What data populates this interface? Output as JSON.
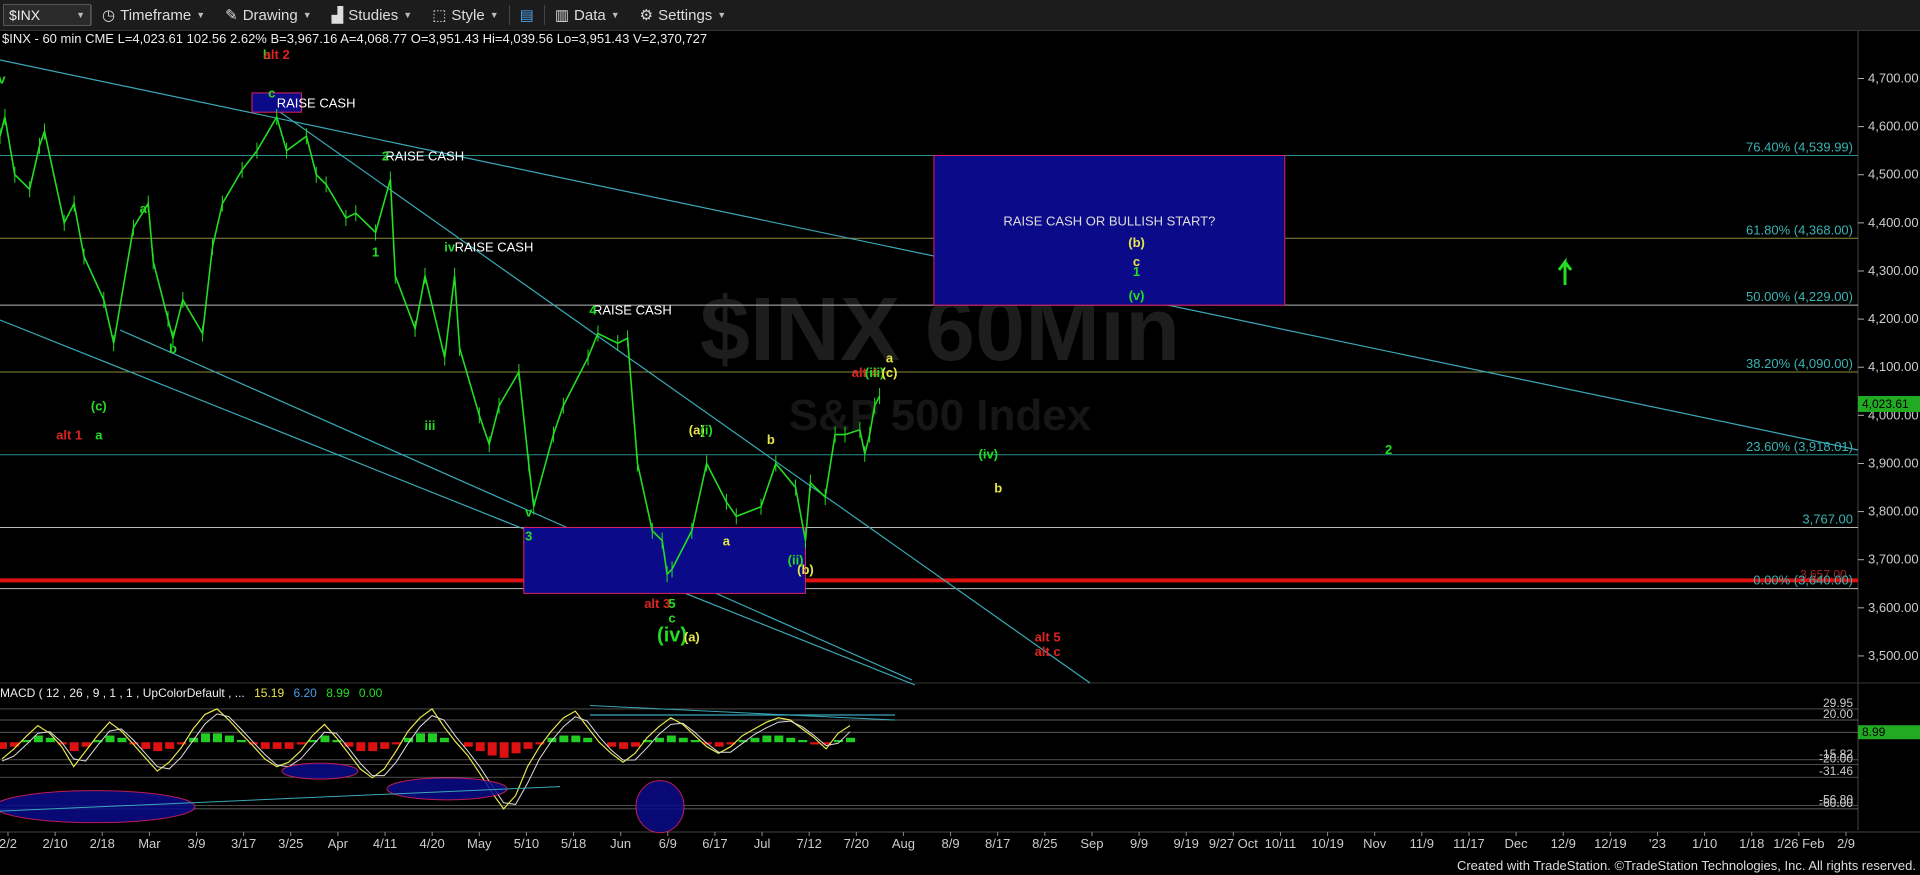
{
  "toolbar": {
    "symbol": "$INX",
    "timeframe": "Timeframe",
    "drawing": "Drawing",
    "studies": "Studies",
    "style": "Style",
    "data": "Data",
    "settings": "Settings"
  },
  "info": {
    "text": "$INX - 60 min  CME  L=4,023.61  102.56  2.62%  B=3,967.16  A=4,068.77  O=3,951.43  Hi=4,039.56  Lo=3,951.43  V=2,370,727"
  },
  "watermark": {
    "line1": "$INX 60Min",
    "line2": "S&P 500 Index"
  },
  "macd_header": {
    "label": "MACD ( 12 , 26 , 9 , 1 , 1 , UpColorDefault , ...",
    "v1": "15.19",
    "v2": "6.20",
    "v3": "8.99",
    "v4": "0.00"
  },
  "credit": "Created with TradeStation. ©TradeStation Technologies, Inc. All rights reserved.",
  "colors": {
    "up": "#22dd22",
    "raise_box": "#0b0b8a",
    "box_border": "#dd2266",
    "trend": "#3aa8b8",
    "fib": "#2a8f8f",
    "red_line": "#dd1111",
    "yellow": "#e6e64a",
    "macd_line": "#e6e64a",
    "macd_hist_up": "#22cc22",
    "macd_hist_dn": "#dd1111"
  },
  "chart_data": {
    "type": "line",
    "title": "$INX - 60 min",
    "price_axis": {
      "ticks": [
        "4,700.00",
        "4,600.00",
        "4,500.00",
        "4,400.00",
        "4,300.00",
        "4,200.00",
        "4,100.00",
        "4,000.00",
        "3,900.00",
        "3,800.00",
        "3,700.00",
        "3,600.00",
        "3,500.00"
      ],
      "ylim": [
        3450,
        4780
      ]
    },
    "date_axis": [
      "2/2",
      "2/10",
      "2/18",
      "Mar",
      "3/9",
      "3/17",
      "3/25",
      "Apr",
      "4/11",
      "4/20",
      "May",
      "5/10",
      "5/18",
      "Jun",
      "6/9",
      "6/17",
      "Jul",
      "7/12",
      "7/20",
      "Aug",
      "8/9",
      "8/17",
      "8/25",
      "Sep",
      "9/9",
      "9/19",
      "9/27 Oct",
      "10/11",
      "10/19",
      "Nov",
      "11/9",
      "11/17",
      "Dec",
      "12/9",
      "12/19",
      "'23",
      "1/10",
      "1/18",
      "1/26 Feb",
      "2/9"
    ],
    "last_price": "4,023.61",
    "price_path": [
      [
        "2/1",
        4580
      ],
      [
        "2/2",
        4620
      ],
      [
        "2/4",
        4500
      ],
      [
        "2/7",
        4470
      ],
      [
        "2/9",
        4560
      ],
      [
        "2/10",
        4590
      ],
      [
        "2/14",
        4400
      ],
      [
        "2/16",
        4440
      ],
      [
        "2/18",
        4330
      ],
      [
        "2/22",
        4240
      ],
      [
        "2/24",
        4150
      ],
      [
        "2/28",
        4390
      ],
      [
        "3/3",
        4440
      ],
      [
        "3/4",
        4320
      ],
      [
        "3/7",
        4200
      ],
      [
        "3/8",
        4160
      ],
      [
        "3/10",
        4240
      ],
      [
        "3/14",
        4170
      ],
      [
        "3/16",
        4350
      ],
      [
        "3/18",
        4440
      ],
      [
        "3/22",
        4510
      ],
      [
        "3/25",
        4550
      ],
      [
        "3/29",
        4620
      ],
      [
        "3/31",
        4550
      ],
      [
        "4/4",
        4580
      ],
      [
        "4/6",
        4500
      ],
      [
        "4/8",
        4480
      ],
      [
        "4/12",
        4410
      ],
      [
        "4/14",
        4420
      ],
      [
        "4/18",
        4380
      ],
      [
        "4/21",
        4490
      ],
      [
        "4/22",
        4290
      ],
      [
        "4/26",
        4180
      ],
      [
        "4/28",
        4290
      ],
      [
        "5/2",
        4120
      ],
      [
        "5/4",
        4290
      ],
      [
        "5/5",
        4140
      ],
      [
        "5/9",
        4000
      ],
      [
        "5/11",
        3940
      ],
      [
        "5/13",
        4020
      ],
      [
        "5/17",
        4090
      ],
      [
        "5/19",
        3900
      ],
      [
        "5/20",
        3810
      ],
      [
        "5/24",
        3960
      ],
      [
        "5/26",
        4020
      ],
      [
        "5/31",
        4120
      ],
      [
        "6/2",
        4170
      ],
      [
        "6/6",
        4150
      ],
      [
        "6/8",
        4160
      ],
      [
        "6/10",
        3900
      ],
      [
        "6/13",
        3760
      ],
      [
        "6/15",
        3740
      ],
      [
        "6/16",
        3670
      ],
      [
        "6/17",
        3680
      ],
      [
        "6/21",
        3760
      ],
      [
        "6/24",
        3900
      ],
      [
        "6/28",
        3820
      ],
      [
        "6/30",
        3790
      ],
      [
        "7/5",
        3810
      ],
      [
        "7/8",
        3900
      ],
      [
        "7/12",
        3850
      ],
      [
        "7/14",
        3740
      ],
      [
        "7/15",
        3860
      ],
      [
        "7/18",
        3830
      ],
      [
        "7/20",
        3960
      ],
      [
        "7/22",
        3960
      ],
      [
        "7/25",
        3970
      ],
      [
        "7/26",
        3920
      ],
      [
        "7/27",
        3960
      ],
      [
        "7/28",
        4020
      ],
      [
        "7/29",
        4040
      ]
    ],
    "horizontal_levels": [
      {
        "label": "76.40% (4,539.99)",
        "value": 4539.99
      },
      {
        "label": "61.80% (4,368.00)",
        "value": 4368.0
      },
      {
        "label": "50.00% (4,229.00)",
        "value": 4229.0
      },
      {
        "label": "38.20% (4,090.00)",
        "value": 4090.0
      },
      {
        "label": "23.60% (3,918.01)",
        "value": 3918.01
      },
      {
        "label": "3,767.00",
        "value": 3767.0
      },
      {
        "label": "0.00% (3,640.00)",
        "value": 3640.0
      }
    ],
    "red_level": {
      "label": "3,657.00",
      "value": 3657
    },
    "boxes": [
      {
        "label": "RAISE CASH OR BULLISH START?",
        "x0": "8/9",
        "x1": "10/19",
        "y0": 4229,
        "y1": 4539.99
      }
    ],
    "annotations": [
      {
        "text": "RAISE CASH",
        "x": "3/29",
        "y": 4640
      },
      {
        "text": "RAISE CASH",
        "x": "4/20",
        "y": 4530
      },
      {
        "text": "RAISE CASH",
        "x": "5/4",
        "y": 4340
      },
      {
        "text": "RAISE CASH",
        "x": "6/1",
        "y": 4210
      },
      {
        "text": "iv",
        "x": "2/1",
        "y": 4690,
        "color": "green"
      },
      {
        "text": "b",
        "x": "3/27",
        "y": 4740,
        "color": "green"
      },
      {
        "text": "alt 2",
        "x": "3/29",
        "y": 4740,
        "color": "red"
      },
      {
        "text": "c",
        "x": "3/28",
        "y": 4660,
        "color": "green"
      },
      {
        "text": "a",
        "x": "3/2",
        "y": 4420,
        "color": "green"
      },
      {
        "text": "b",
        "x": "3/8",
        "y": 4130,
        "color": "green"
      },
      {
        "text": "(c)",
        "x": "2/21",
        "y": 4010,
        "color": "green"
      },
      {
        "text": "a",
        "x": "2/21",
        "y": 3950,
        "color": "green"
      },
      {
        "text": "alt 1",
        "x": "2/15",
        "y": 3950,
        "color": "red"
      },
      {
        "text": "2",
        "x": "4/20",
        "y": 4530,
        "color": "green"
      },
      {
        "text": "1",
        "x": "4/18",
        "y": 4330,
        "color": "green"
      },
      {
        "text": "iv",
        "x": "5/3",
        "y": 4340,
        "color": "green"
      },
      {
        "text": "iii",
        "x": "4/29",
        "y": 3970,
        "color": "green"
      },
      {
        "text": "v",
        "x": "5/19",
        "y": 3790,
        "color": "green"
      },
      {
        "text": "3",
        "x": "5/19",
        "y": 3740,
        "color": "green"
      },
      {
        "text": "4",
        "x": "6/1",
        "y": 4210,
        "color": "green"
      },
      {
        "text": "alt 3",
        "x": "6/14",
        "y": 3600,
        "color": "red"
      },
      {
        "text": "5",
        "x": "6/17",
        "y": 3600,
        "color": "green"
      },
      {
        "text": "c",
        "x": "6/17",
        "y": 3570,
        "color": "green"
      },
      {
        "text": "(iv)",
        "x": "6/17",
        "y": 3530,
        "color": "green"
      },
      {
        "text": "(a)",
        "x": "6/21",
        "y": 3530,
        "color": "yellow"
      },
      {
        "text": "(a)",
        "x": "6/22",
        "y": 3960,
        "color": "yellow"
      },
      {
        "text": "(i)",
        "x": "6/24",
        "y": 3960,
        "color": "green"
      },
      {
        "text": "a",
        "x": "6/28",
        "y": 3730,
        "color": "yellow"
      },
      {
        "text": "b",
        "x": "7/7",
        "y": 3940,
        "color": "yellow"
      },
      {
        "text": "(ii)",
        "x": "7/12",
        "y": 3690,
        "color": "green"
      },
      {
        "text": "(b)",
        "x": "7/14",
        "y": 3670,
        "color": "yellow"
      },
      {
        "text": "alt 4",
        "x": "7/26",
        "y": 4080,
        "color": "red"
      },
      {
        "text": "(iii)",
        "x": "7/28",
        "y": 4080,
        "color": "green"
      },
      {
        "text": "a",
        "x": "7/31",
        "y": 4110,
        "color": "yellow"
      },
      {
        "text": "(c)",
        "x": "7/31",
        "y": 4080,
        "color": "yellow"
      },
      {
        "text": "(b)",
        "x": "9/19",
        "y": 4350,
        "color": "yellow"
      },
      {
        "text": "c",
        "x": "9/19",
        "y": 4310,
        "color": "yellow"
      },
      {
        "text": "1",
        "x": "9/19",
        "y": 4290,
        "color": "green"
      },
      {
        "text": "(v)",
        "x": "9/19",
        "y": 4240,
        "color": "green"
      },
      {
        "text": "(iv)",
        "x": "8/20",
        "y": 3910,
        "color": "green"
      },
      {
        "text": "b",
        "x": "8/22",
        "y": 3840,
        "color": "yellow"
      },
      {
        "text": "alt 5",
        "x": "9/1",
        "y": 3530,
        "color": "red"
      },
      {
        "text": "alt c",
        "x": "9/1",
        "y": 3500,
        "color": "red"
      },
      {
        "text": "2",
        "x": "11/9",
        "y": 3920,
        "color": "green"
      }
    ],
    "macd": {
      "ticks": [
        "29.95",
        "20.00",
        "8.99",
        "-15.82",
        "-20.00",
        "-31.46",
        "-56.80",
        "-60.00"
      ],
      "ylim": [
        -70,
        38
      ],
      "values": [
        -15,
        -6,
        5,
        15,
        8,
        -4,
        -22,
        -8,
        6,
        18,
        10,
        -2,
        -14,
        -26,
        -18,
        -5,
        12,
        25,
        30,
        20,
        8,
        -3,
        -15,
        -22,
        -18,
        -8,
        6,
        16,
        4,
        -10,
        -24,
        -32,
        -24,
        -8,
        10,
        22,
        30,
        14,
        0,
        -12,
        -28,
        -45,
        -60,
        -48,
        -22,
        -4,
        10,
        22,
        28,
        14,
        0,
        -10,
        -18,
        -10,
        4,
        14,
        22,
        16,
        6,
        -4,
        -10,
        -4,
        6,
        12,
        18,
        22,
        20,
        12,
        4,
        -6,
        8,
        15
      ],
      "hist": [
        -6,
        -4,
        2,
        6,
        4,
        -2,
        -8,
        -4,
        2,
        6,
        4,
        -2,
        -6,
        -8,
        -6,
        -2,
        4,
        8,
        8,
        6,
        2,
        -2,
        -6,
        -6,
        -6,
        -2,
        2,
        6,
        2,
        -4,
        -8,
        -8,
        -6,
        -2,
        4,
        8,
        8,
        4,
        0,
        -4,
        -8,
        -12,
        -14,
        -10,
        -6,
        -2,
        4,
        6,
        6,
        4,
        0,
        -4,
        -6,
        -4,
        2,
        4,
        6,
        4,
        2,
        -2,
        -4,
        -2,
        2,
        4,
        6,
        6,
        4,
        2,
        -2,
        -2,
        2,
        4
      ]
    }
  }
}
